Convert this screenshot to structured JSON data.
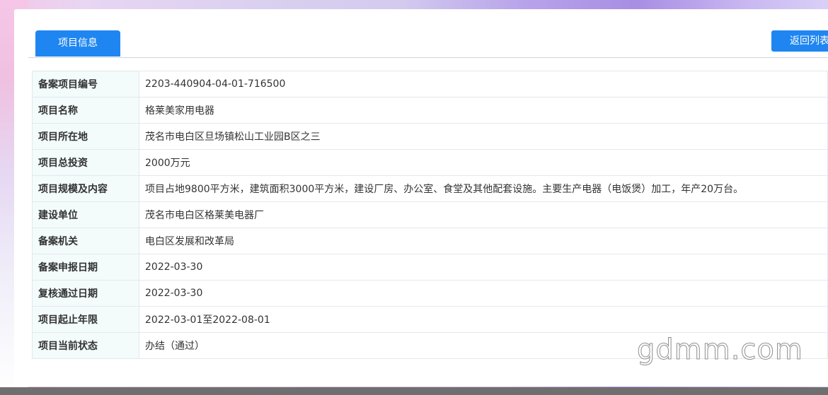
{
  "tabs": {
    "active_label": "项目信息"
  },
  "actions": {
    "back_label": "返回列表"
  },
  "project": {
    "rows": [
      {
        "label": "备案项目编号",
        "value": "2203-440904-04-01-716500"
      },
      {
        "label": "项目名称",
        "value": "格莱美家用电器"
      },
      {
        "label": "项目所在地",
        "value": "茂名市电白区旦场镇松山工业园B区之三"
      },
      {
        "label": "项目总投资",
        "value": "2000万元"
      },
      {
        "label": "项目规模及内容",
        "value": "项目占地9800平方米，建筑面积3000平方米，建设厂房、办公室、食堂及其他配套设施。主要生产电器（电饭煲）加工，年产20万台。"
      },
      {
        "label": "建设单位",
        "value": "茂名市电白区格莱美电器厂"
      },
      {
        "label": "备案机关",
        "value": "电白区发展和改革局"
      },
      {
        "label": "备案申报日期",
        "value": "2022-03-30"
      },
      {
        "label": "复核通过日期",
        "value": "2022-03-30"
      },
      {
        "label": "项目起止年限",
        "value": "2022-03-01至2022-08-01"
      },
      {
        "label": "项目当前状态",
        "value": "办结（通过）"
      }
    ]
  },
  "watermark": {
    "text": "gdmm.com"
  },
  "colors": {
    "accent": "#1f86f1",
    "label_bg": "#f3fbfb",
    "border": "#e3e8ee"
  }
}
